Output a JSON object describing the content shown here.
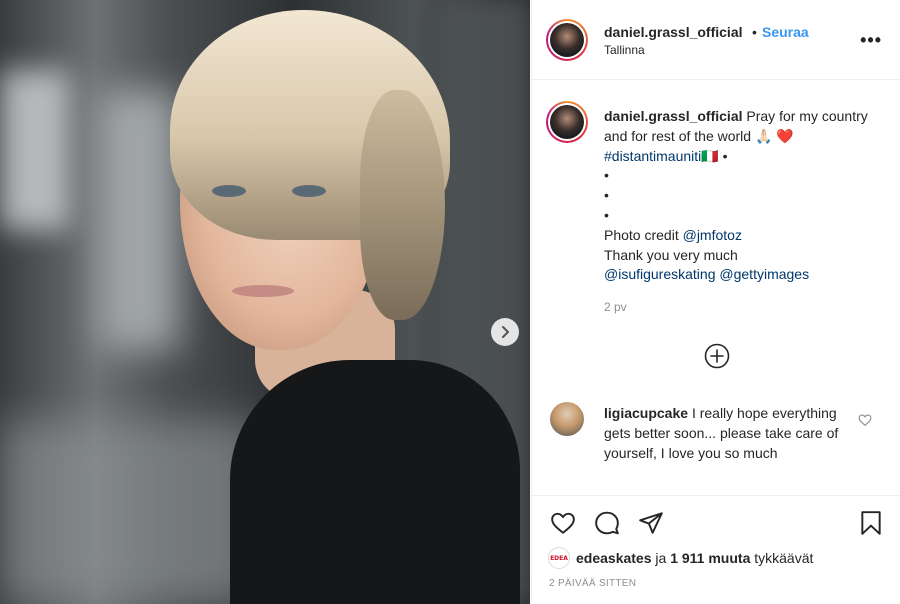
{
  "post": {
    "username": "daniel.grassl_official",
    "dot": "•",
    "follow_label": "Seuraa",
    "location": "Tallinna",
    "more_icon": "more-horizontal-icon"
  },
  "caption": {
    "username": "daniel.grassl_official",
    "text": "Pray for my country and for rest of the world",
    "emoji": "🙏🏻 ❤️",
    "hashtag": "#distantimauniti",
    "flag": "🇮🇹",
    "bullet": "•",
    "credit_label": "Photo credit",
    "credit_mention": "@jmfotoz",
    "thanks": "Thank you very much",
    "mention_1": "@isufigureskating",
    "mention_2": "@gettyimages",
    "age": "2 pv"
  },
  "load_more_icon": "plus-circle-icon",
  "comment": {
    "username": "ligiacupcake",
    "text": "I really hope everything gets better soon... please take care of yourself, I love you so much"
  },
  "likes": {
    "avatar_text": "EDEA",
    "first_liker": "edeaskates",
    "connector": "ja",
    "count_text": "1 911 muuta",
    "suffix": "tykkäävät"
  },
  "timestamp": "2 PÄIVÄÄ SITTEN",
  "icons": {
    "like": "heart-icon",
    "comment": "comment-bubble-icon",
    "share": "paper-plane-icon",
    "save": "bookmark-icon",
    "next": "chevron-right-icon"
  },
  "colors": {
    "accent": "#3897f0",
    "link": "#00376b",
    "muted": "#8e8e8e",
    "text": "#262626"
  }
}
